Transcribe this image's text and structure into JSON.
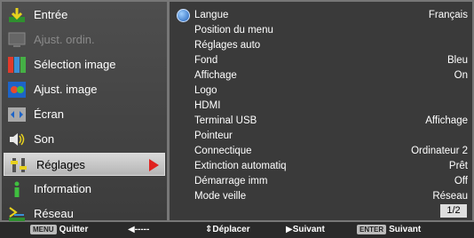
{
  "left_menu": {
    "items": [
      {
        "label": "Entrée",
        "icon": "input-icon",
        "state": "normal"
      },
      {
        "label": "Ajust. ordin.",
        "icon": "computer-adjust-icon",
        "state": "disabled"
      },
      {
        "label": "Sélection image",
        "icon": "image-select-icon",
        "state": "normal"
      },
      {
        "label": "Ajust. image",
        "icon": "image-adjust-icon",
        "state": "normal"
      },
      {
        "label": "Écran",
        "icon": "screen-icon",
        "state": "normal"
      },
      {
        "label": "Son",
        "icon": "speaker-icon",
        "state": "normal"
      },
      {
        "label": "Réglages",
        "icon": "settings-icon",
        "state": "selected"
      },
      {
        "label": "Information",
        "icon": "information-icon",
        "state": "normal"
      },
      {
        "label": "Réseau",
        "icon": "network-icon",
        "state": "normal"
      }
    ]
  },
  "settings_panel": {
    "rows": [
      {
        "name": "Langue",
        "value": "Français"
      },
      {
        "name": "Position du menu",
        "value": ""
      },
      {
        "name": "Réglages auto",
        "value": ""
      },
      {
        "name": "Fond",
        "value": "Bleu"
      },
      {
        "name": "Affichage",
        "value": "On"
      },
      {
        "name": "Logo",
        "value": ""
      },
      {
        "name": "HDMI",
        "value": ""
      },
      {
        "name": "Terminal USB",
        "value": "Affichage"
      },
      {
        "name": "Pointeur",
        "value": ""
      },
      {
        "name": "Connectique",
        "value": "Ordinateur 2"
      },
      {
        "name": "Extinction automatiq",
        "value": "Prêt"
      },
      {
        "name": "Démarrage imm",
        "value": "Off"
      },
      {
        "name": "Mode veille",
        "value": "Réseau"
      }
    ],
    "page_indicator": "1/2"
  },
  "bottom_bar": {
    "quit_key": "MENU",
    "quit_label": "Quitter",
    "back_arrow": "◀-----",
    "move_label": "Déplacer",
    "next_label": "Suivant",
    "enter_key": "ENTER",
    "enter_label": "Suivant"
  },
  "colors": {
    "selection_arrow": "#e0221f",
    "panel_bg": "#3a3a3a",
    "menu_bg": "#454545"
  }
}
